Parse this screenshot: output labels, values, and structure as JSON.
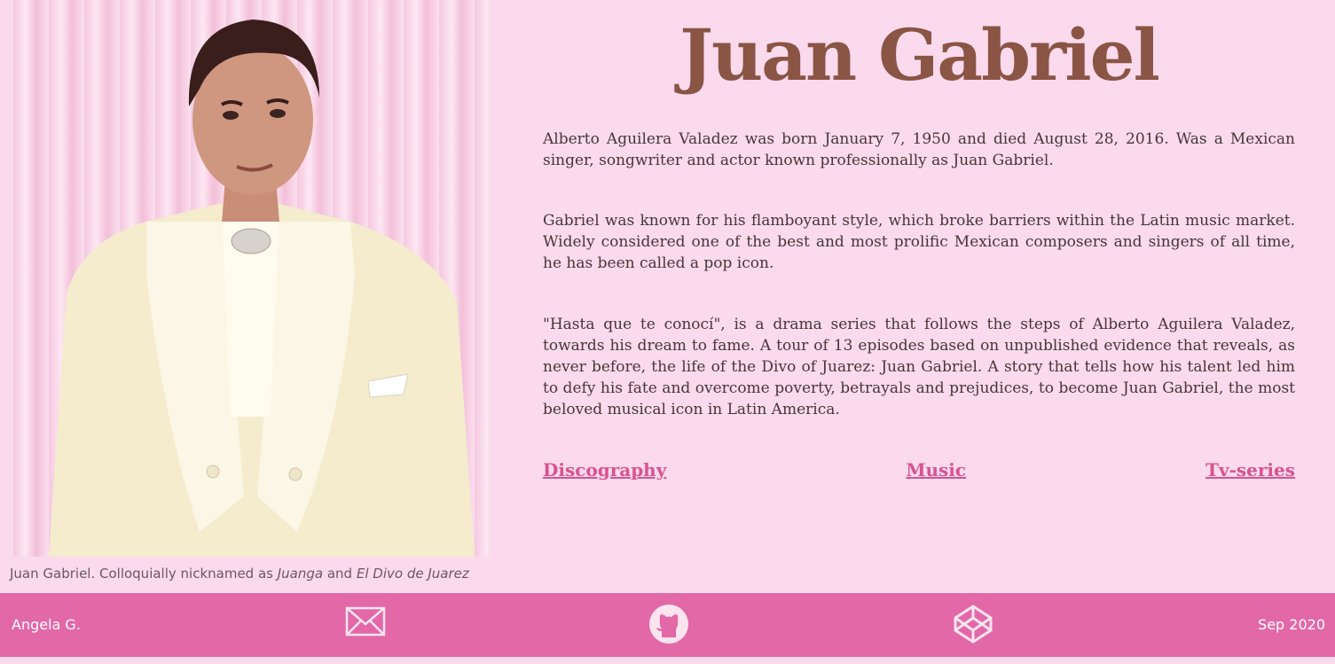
{
  "hero": {
    "title": "Juan Gabriel",
    "caption_prefix": "Juan Gabriel. Colloquially nicknamed as ",
    "caption_nick1": "Juanga",
    "caption_and": " and ",
    "caption_nick2": "El Divo de Juarez"
  },
  "paragraphs": [
    "Alberto Aguilera Valadez was born January 7, 1950 and died August 28, 2016. Was a Mexican singer, songwriter and actor known professionally as Juan Gabriel.",
    "Gabriel was known for his flamboyant style, which broke barriers within the Latin music market. Widely considered one of the best and most prolific Mexican composers and singers of all time, he has been called a pop icon.",
    "\"Hasta que te conocí\", is a drama series that follows the steps of Alberto Aguilera Valadez, towards his dream to fame. A tour of 13 episodes based on unpublished evidence that reveals, as never before, the life of the Divo of Juarez: Juan Gabriel. A story that tells how his talent led him to defy his fate and overcome poverty, betrayals and prejudices, to become Juan Gabriel, the most beloved musical icon in Latin America."
  ],
  "links": {
    "discography": "Discography",
    "music": "Music",
    "tvseries": "Tv-series"
  },
  "footer": {
    "author": "Angela G.",
    "date": "Sep 2020",
    "icons": [
      "mail-icon",
      "github-icon",
      "codepen-icon"
    ]
  },
  "colors": {
    "background": "#fbdaee",
    "footer": "#e268a8",
    "title": "#8a5545",
    "link": "#d9528f"
  }
}
